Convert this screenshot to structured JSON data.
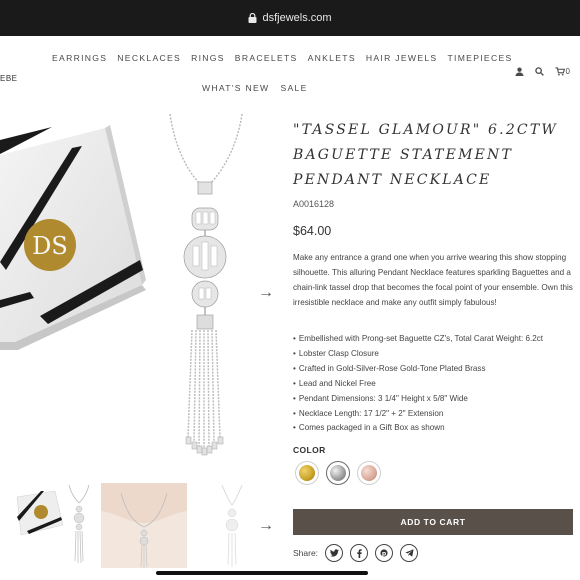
{
  "browser": {
    "url": "dsfjewels.com"
  },
  "header": {
    "brand_fragment": "EBE",
    "nav_row1": [
      "EARRINGS",
      "NECKLACES",
      "RINGS",
      "BRACELETS",
      "ANKLETS",
      "HAIR JEWELS",
      "TIMEPIECES"
    ],
    "nav_row2": [
      "WHAT'S NEW",
      "SALE"
    ],
    "icons": [
      "user-icon",
      "search-icon",
      "cart-icon"
    ],
    "cart_count": "0"
  },
  "gallery": {
    "box_logo": "DS"
  },
  "product": {
    "title": "\"TASSEL GLAMOUR\" 6.2CTW BAGUETTE STATEMENT PENDANT NECKLACE",
    "sku": "A0016128",
    "price": "$64.00",
    "description": "Make any entrance a grand one when you arrive wearing this show stopping silhouette. This alluring Pendant Necklace features sparkling Baguettes and a chain-link tassel drop that becomes the focal point of your ensemble. Own this irresistible necklace and make any outfit simply fabulous!",
    "features": [
      "Embellished with Prong-set Baguette CZ's, Total Carat Weight: 6.2ct",
      "Lobster Clasp Closure",
      "Crafted in Gold-Silver-Rose Gold-Tone Plated Brass",
      "Lead and Nickel Free",
      "Pendant Dimensions: 3 1/4\" Height x 5/8\" Wide",
      "Necklace Length: 17 1/2\" + 2\" Extension",
      "Comes packaged in a Gift Box as shown"
    ],
    "color_label": "COLOR",
    "colors": [
      {
        "name": "gold",
        "hex": "#c9a227"
      },
      {
        "name": "silver",
        "hex": "#9a9a9a"
      },
      {
        "name": "rose-gold",
        "hex": "#d9a99a"
      }
    ],
    "selected_color": "silver",
    "add_to_cart": "ADD TO CART",
    "share_label": "Share:",
    "share_icons": [
      "twitter-icon",
      "facebook-icon",
      "pinterest-icon",
      "telegram-icon"
    ]
  },
  "theme": {
    "button_color": "#5a504a",
    "gold_logo": "#b08a2e"
  }
}
